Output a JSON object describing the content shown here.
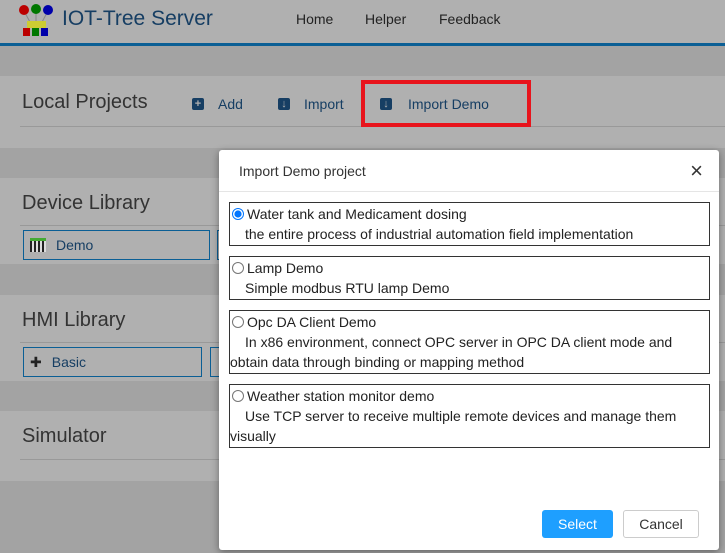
{
  "header": {
    "brand": "IOT-Tree Server",
    "nav": [
      "Home",
      "Helper",
      "Feedback"
    ]
  },
  "local_projects": {
    "title": "Local Projects",
    "add": "Add",
    "import": "Import",
    "import_demo": "Import Demo"
  },
  "device_library": {
    "title": "Device Library",
    "items": [
      "Demo"
    ]
  },
  "hmi_library": {
    "title": "HMI Library",
    "items": [
      "Basic"
    ]
  },
  "simulator": {
    "title": "Simulator"
  },
  "dialog": {
    "title": "Import Demo project",
    "options": [
      {
        "name": "Water tank and Medicament dosing",
        "desc": "the entire process of industrial automation field implementation",
        "checked": true
      },
      {
        "name": "Lamp Demo",
        "desc": "Simple modbus RTU lamp Demo",
        "checked": false
      },
      {
        "name": "Opc DA Client Demo",
        "desc": "In x86 environment, connect OPC server in OPC DA client mode and",
        "desc2": "obtain data through binding or mapping method",
        "checked": false
      },
      {
        "name": "Weather station monitor demo",
        "desc": "Use TCP server to receive multiple remote devices and manage them",
        "desc2": "visually",
        "checked": false
      }
    ],
    "select": "Select",
    "cancel": "Cancel"
  },
  "colors": {
    "accent": "#1e90ff",
    "highlight": "#e8141c",
    "brand": "#163e63"
  }
}
